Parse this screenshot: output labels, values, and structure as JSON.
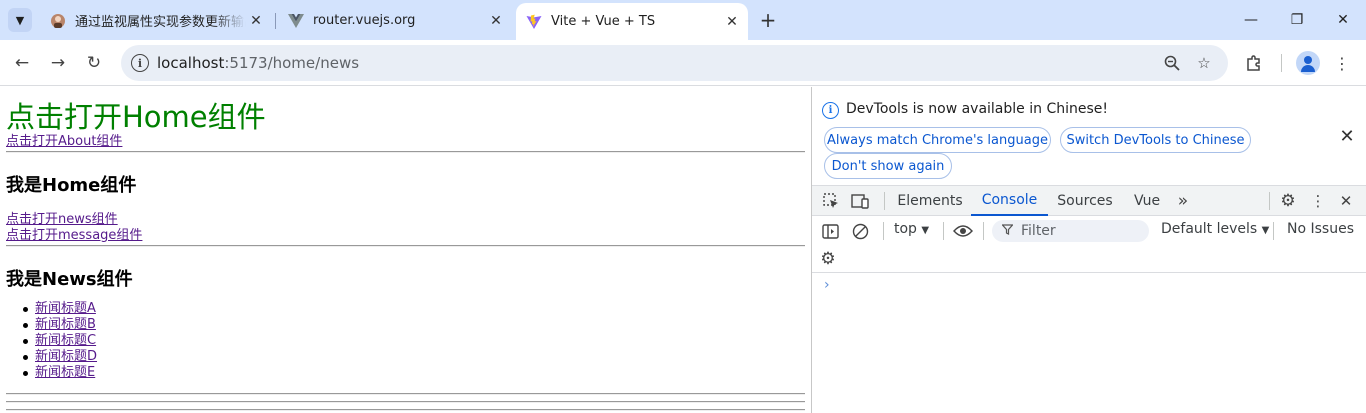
{
  "browser": {
    "tabs": [
      {
        "title": "通过监视属性实现参数更新输出"
      },
      {
        "title": "router.vuejs.org"
      },
      {
        "title": "Vite + Vue + TS"
      }
    ],
    "url_host": "localhost",
    "url_rest": ":5173/home/news"
  },
  "page": {
    "heading_home_link": "点击打开Home组件",
    "link_about": "点击打开About组件",
    "home_title": "我是Home组件",
    "link_news": "点击打开news组件",
    "link_message": "点击打开message组件",
    "news_title": "我是News组件",
    "news_items": [
      "新闻标题A",
      "新闻标题B",
      "新闻标题C",
      "新闻标题D",
      "新闻标题E"
    ]
  },
  "devtools": {
    "banner_message": "DevTools is now available in Chinese!",
    "btn_match": "Always match Chrome's language",
    "btn_switch": "Switch DevTools to Chinese",
    "btn_dont_show": "Don't show again",
    "tabs": [
      "Elements",
      "Console",
      "Sources",
      "Vue"
    ],
    "context": "top",
    "filter_placeholder": "Filter",
    "levels": "Default levels",
    "issues": "No Issues",
    "prompt": "›"
  },
  "colors": {
    "tabstrip": "#d3e3fd",
    "home_heading": "#008000",
    "visited_link": "#551a8b",
    "accent": "#0b57d0"
  }
}
